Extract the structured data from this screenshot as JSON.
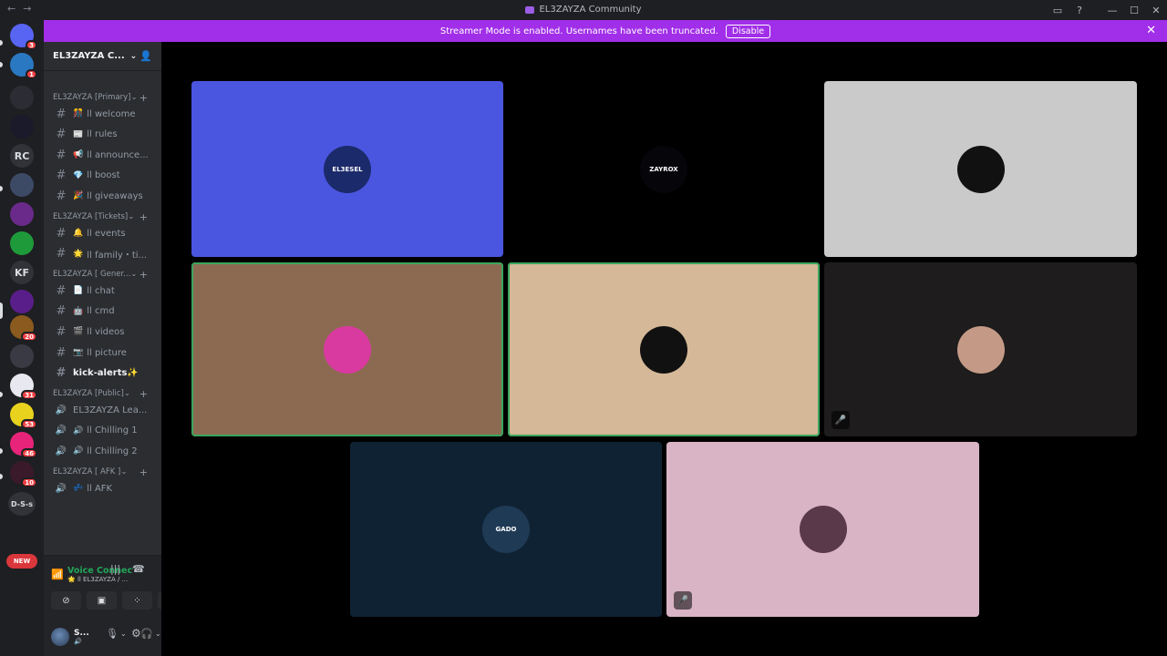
{
  "window": {
    "title": "EL3ZAYZA Community",
    "controls": {
      "inbox": "▭",
      "help": "?",
      "minimize": "—",
      "maximize": "☐",
      "close": "✕"
    }
  },
  "banner": {
    "text": "Streamer Mode is enabled. Usernames have been truncated.",
    "button": "Disable"
  },
  "guilds": [
    {
      "label": "",
      "badge": "3",
      "color": "#5865f2",
      "icon": "discord-home-icon"
    },
    {
      "label": "",
      "badge": "1",
      "color": "#2a78c2",
      "icon": "server-icon"
    },
    {
      "label": "",
      "badge": "",
      "color": "#2c2c34",
      "icon": "server-icon"
    },
    {
      "label": "",
      "badge": "",
      "color": "#1a1a2a",
      "icon": "server-icon"
    },
    {
      "label": "RC",
      "badge": "",
      "color": "#313338",
      "icon": "server-icon"
    },
    {
      "label": "",
      "badge": "",
      "color": "#3c4a66",
      "icon": "server-icon"
    },
    {
      "label": "",
      "badge": "",
      "color": "#6a2a8a",
      "icon": "server-icon"
    },
    {
      "label": "",
      "badge": "",
      "color": "#1f9a3a",
      "icon": "server-icon"
    },
    {
      "label": "KF",
      "badge": "",
      "color": "#313338",
      "icon": "server-icon"
    },
    {
      "label": "",
      "badge": "",
      "color": "#5a1e8a",
      "icon": "server-icon"
    },
    {
      "label": "",
      "badge": "20",
      "color": "#8a5a1e",
      "icon": "server-icon"
    },
    {
      "label": "",
      "badge": "",
      "color": "#3a3a44",
      "icon": "server-icon"
    },
    {
      "label": "",
      "badge": "31",
      "color": "#e8e8f0",
      "icon": "server-icon"
    },
    {
      "label": "",
      "badge": "53",
      "color": "#e8d21e",
      "icon": "server-icon"
    },
    {
      "label": "",
      "badge": "46",
      "color": "#e8247a",
      "icon": "server-icon"
    },
    {
      "label": "",
      "badge": "10",
      "color": "#3a1a2a",
      "icon": "server-icon"
    },
    {
      "label": "D-S-s",
      "badge": "",
      "color": "#313338",
      "icon": "server-icon"
    }
  ],
  "new_badge": "NEW",
  "server": {
    "name": "EL3ZAYZA C..."
  },
  "categories": [
    {
      "name": "EL3ZAYZA [Primary]",
      "channels": [
        {
          "emoji": "🎊",
          "name": "ll welcome"
        },
        {
          "emoji": "📰",
          "name": "ll rules"
        },
        {
          "emoji": "📢",
          "name": "ll announce..."
        },
        {
          "emoji": "💎",
          "name": "ll boost"
        },
        {
          "emoji": "🎉",
          "name": "ll giveaways"
        }
      ]
    },
    {
      "name": "EL3ZAYZA [Tickets]",
      "channels": [
        {
          "emoji": "🔔",
          "name": "ll events"
        },
        {
          "emoji": "🌟",
          "name": "ll family・ti..."
        }
      ]
    },
    {
      "name": "EL3ZAYZA [ Gener...",
      "channels": [
        {
          "emoji": "📄",
          "name": "ll chat"
        },
        {
          "emoji": "🤖",
          "name": "ll cmd"
        },
        {
          "emoji": "🎬",
          "name": "ll videos"
        },
        {
          "emoji": "📷",
          "name": "ll picture"
        },
        {
          "emoji": "",
          "name": "kick-alerts✨"
        }
      ]
    },
    {
      "name": "EL3ZAYZA [Public]",
      "channels": [
        {
          "emoji": "",
          "name": "EL3ZAYZA Lea..."
        },
        {
          "emoji": "🔊",
          "name": "ll Chilling 1"
        },
        {
          "emoji": "🔊",
          "name": "ll Chilling 2"
        }
      ]
    },
    {
      "name": "EL3ZAYZA [ AFK ]",
      "channels": [
        {
          "emoji": "💤",
          "name": "ll AFK"
        }
      ]
    }
  ],
  "voice": {
    "status": "Voice Connected",
    "location": "🌟 ll EL3ZAYZA / ..."
  },
  "user": {
    "name": "S...",
    "status": "🔊"
  },
  "tiles": [
    {
      "bg": "#4a56e0",
      "avatar": "#1b2a6a",
      "avatar_text": "EL3ESEL",
      "speaking": false,
      "muted": false
    },
    {
      "bg": "#000000",
      "avatar": "#05050a",
      "avatar_text": "ZAYROX",
      "speaking": false,
      "muted": false
    },
    {
      "bg": "#cacaca",
      "avatar": "#111111",
      "avatar_text": "",
      "speaking": false,
      "muted": false
    },
    {
      "bg": "#8c6a52",
      "avatar": "#d93aa0",
      "avatar_text": "",
      "speaking": true,
      "muted": false
    },
    {
      "bg": "#d4b898",
      "avatar": "#111111",
      "avatar_text": "",
      "speaking": true,
      "muted": false
    },
    {
      "bg": "#1e1c1c",
      "avatar": "#c49a86",
      "avatar_text": "",
      "speaking": false,
      "muted": true
    },
    {
      "bg": "#0f2233",
      "avatar": "#1f3a55",
      "avatar_text": "GADO",
      "speaking": false,
      "muted": false
    },
    {
      "bg": "#d8b4c4",
      "avatar": "#5a3a4a",
      "avatar_text": "",
      "speaking": false,
      "muted": true
    }
  ]
}
